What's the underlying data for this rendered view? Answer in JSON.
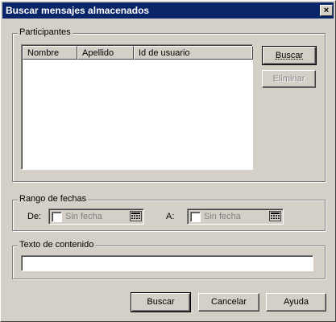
{
  "window": {
    "title": "Buscar mensajes almacenados",
    "close_glyph": "×"
  },
  "participants": {
    "legend": "Participantes",
    "columns": [
      "Nombre",
      "Apellido",
      "Id de usuario"
    ],
    "rows": [],
    "search_button": "Buscar",
    "remove_button": "Eliminar"
  },
  "date_range": {
    "legend": "Rango de fechas",
    "from_label": "De:",
    "to_label": "A:",
    "from_value": "Sin fecha",
    "to_value": "Sin fecha",
    "from_checked": false,
    "to_checked": false,
    "icon": "calendar-icon"
  },
  "content": {
    "legend": "Texto de contenido",
    "value": ""
  },
  "footer": {
    "search_button": "Buscar",
    "cancel_button": "Cancelar",
    "help_button": "Ayuda"
  }
}
